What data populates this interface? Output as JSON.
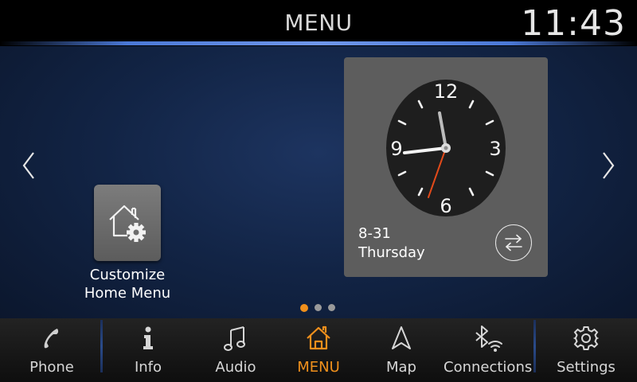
{
  "header": {
    "title": "MENU",
    "time": "11:43"
  },
  "tiles": {
    "customize": {
      "label_line1": "Customize",
      "label_line2": "Home Menu",
      "icon": "home-gear-icon"
    },
    "clock": {
      "date": "8-31",
      "weekday": "Thursday",
      "dial_numbers": [
        "12",
        "3",
        "6",
        "9"
      ]
    }
  },
  "pager": {
    "count": 3,
    "active": 1
  },
  "nav": {
    "items": [
      {
        "label": "Phone",
        "icon": "phone-icon"
      },
      {
        "label": "Info",
        "icon": "info-icon"
      },
      {
        "label": "Audio",
        "icon": "music-note-icon"
      },
      {
        "label": "MENU",
        "icon": "home-icon",
        "active": true
      },
      {
        "label": "Map",
        "icon": "navigation-arrow-icon"
      },
      {
        "label": "Connections",
        "icon": "bluetooth-wifi-icon"
      },
      {
        "label": "Settings",
        "icon": "gear-icon"
      }
    ]
  },
  "colors": {
    "accent": "#f0901c",
    "second_hand": "#e24a1a",
    "header_line": "#5a86e0"
  }
}
